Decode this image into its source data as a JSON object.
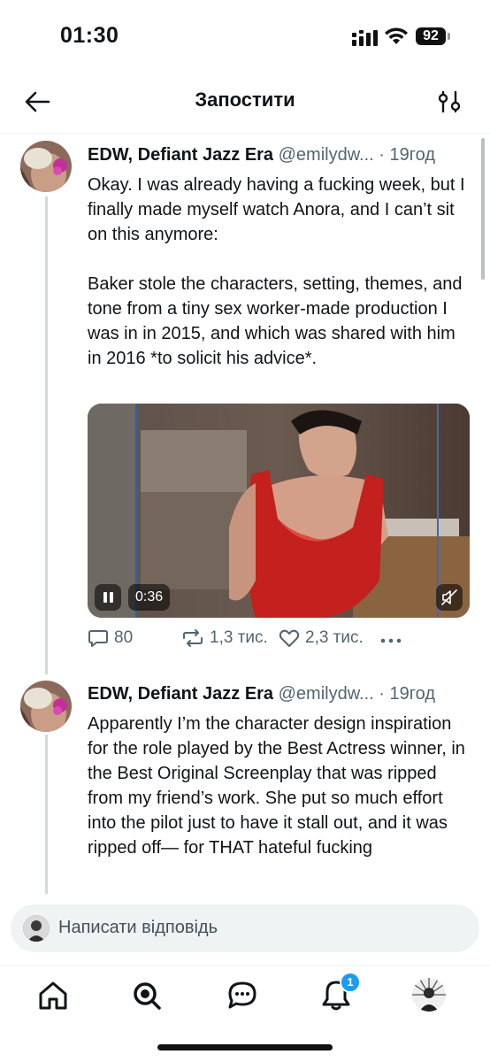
{
  "status": {
    "time": "01:30",
    "battery": "92"
  },
  "header": {
    "title": "Запостити"
  },
  "posts": [
    {
      "name": "EDW, Defiant Jazz Era",
      "handle": "@emilydw...",
      "dot": "·",
      "ago": "19год",
      "text": "Okay. I was already having a fucking week, but I finally made myself watch Anora, and I can’t sit on this anymore:\n\nBaker stole the characters, setting, themes, and tone from a tiny sex worker-made production I was in in 2015, and which was shared with him in 2016 *to solicit his advice*.",
      "video": {
        "duration": "0:36"
      },
      "stats": {
        "replies": "80",
        "reposts": "1,3 тис.",
        "likes": "2,3 тис."
      }
    },
    {
      "name": "EDW, Defiant Jazz Era",
      "handle": "@emilydw...",
      "dot": "·",
      "ago": "19год",
      "text": "Apparently I’m the character design inspiration for the role played by the Best Actress winner, in the Best Original Screenplay that was ripped from my friend’s work. She put so much effort into the pilot just to have it stall out, and it was ripped off— for THAT hateful fucking"
    }
  ],
  "reply": {
    "placeholder": "Написати відповідь"
  },
  "tabbar": {
    "notifications_badge": "1"
  },
  "colors": {
    "accent": "#1d9bf0",
    "muted": "#536471",
    "divider": "#cfd9de"
  }
}
